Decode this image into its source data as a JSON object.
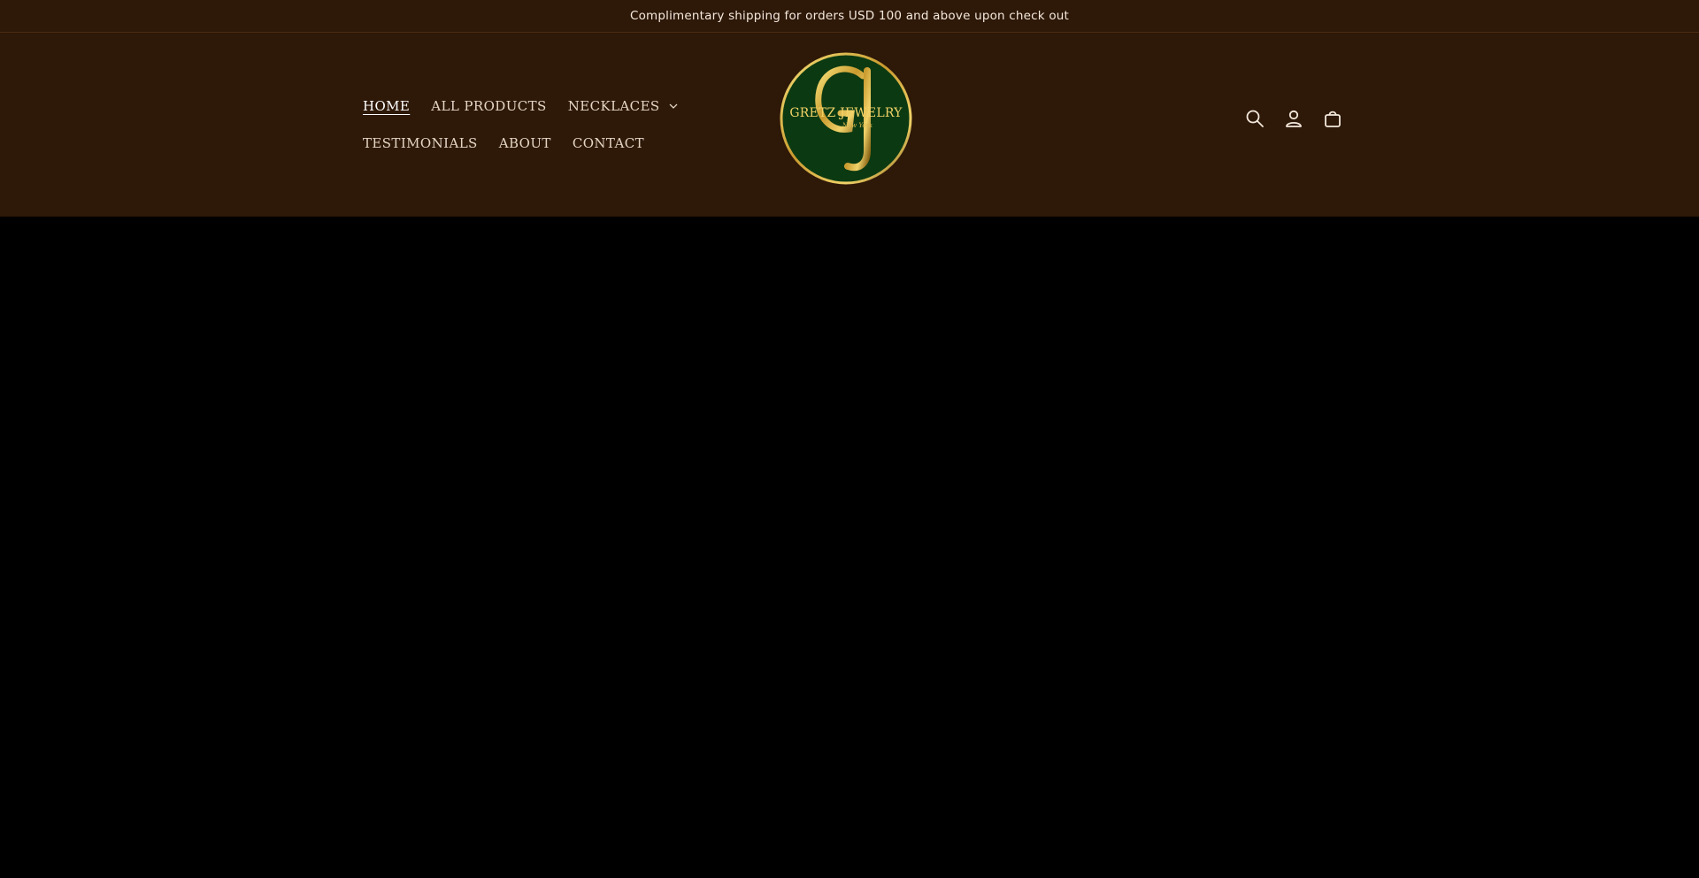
{
  "announcement": {
    "text": "Complimentary shipping for orders USD 100 and above upon check out"
  },
  "nav": {
    "row1": [
      {
        "label": "HOME",
        "active": true
      },
      {
        "label": "ALL PRODUCTS",
        "active": false
      },
      {
        "label": "NECKLACES",
        "active": false,
        "has_dropdown": true
      }
    ],
    "row2": [
      {
        "label": "TESTIMONIALS",
        "active": false
      },
      {
        "label": "ABOUT",
        "active": false
      },
      {
        "label": "CONTACT",
        "active": false
      }
    ]
  },
  "logo": {
    "brand": "GRETZ JEWELRY",
    "sub": "New York",
    "monogram": "GJ"
  },
  "header_icons": [
    "search-icon",
    "account-icon",
    "cart-icon"
  ],
  "colors": {
    "header_bg": "#2e1808",
    "hero_bg": "#000000",
    "logo_green": "#0b3a12",
    "logo_gold": "#d4af37",
    "nav_text": "#e5d6c4"
  }
}
